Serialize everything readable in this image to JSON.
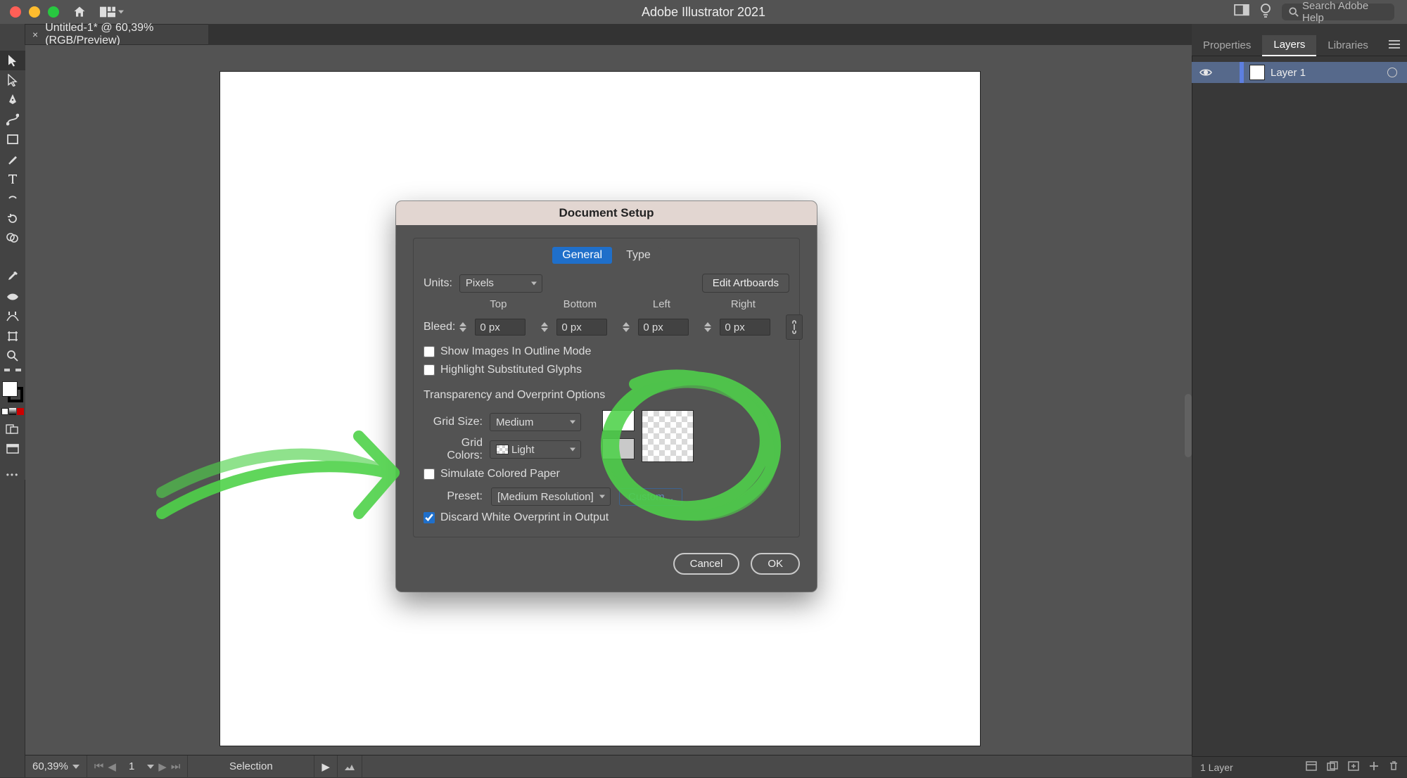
{
  "app": {
    "title": "Adobe Illustrator 2021",
    "search_placeholder": "Search Adobe Help"
  },
  "doc_tab": {
    "name": "Untitled-1* @ 60,39% (RGB/Preview)"
  },
  "status": {
    "zoom": "60,39%",
    "artboard_num": "1",
    "mode": "Selection"
  },
  "right_panel": {
    "tabs": [
      "Properties",
      "Layers",
      "Libraries"
    ],
    "active_tab": "Layers",
    "layer_name": "Layer 1",
    "footer_label": "1 Layer"
  },
  "dialog": {
    "title": "Document Setup",
    "tabs": {
      "general": "General",
      "type": "Type"
    },
    "units_label": "Units:",
    "units_value": "Pixels",
    "edit_artboards": "Edit Artboards",
    "bleed_label": "Bleed:",
    "bleed_heads": {
      "top": "Top",
      "bottom": "Bottom",
      "left": "Left",
      "right": "Right"
    },
    "bleed_values": {
      "top": "0 px",
      "bottom": "0 px",
      "left": "0 px",
      "right": "0 px"
    },
    "cb_outline": "Show Images In Outline Mode",
    "cb_glyphs": "Highlight Substituted Glyphs",
    "transp_heading": "Transparency and Overprint Options",
    "grid_size_label": "Grid Size:",
    "grid_size_value": "Medium",
    "grid_colors_label": "Grid Colors:",
    "grid_colors_value": "Light",
    "cb_paper": "Simulate Colored Paper",
    "preset_label": "Preset:",
    "preset_value": "[Medium Resolution]",
    "custom_btn": "Custom...",
    "cb_overprint": "Discard White Overprint in Output",
    "cancel": "Cancel",
    "ok": "OK"
  }
}
